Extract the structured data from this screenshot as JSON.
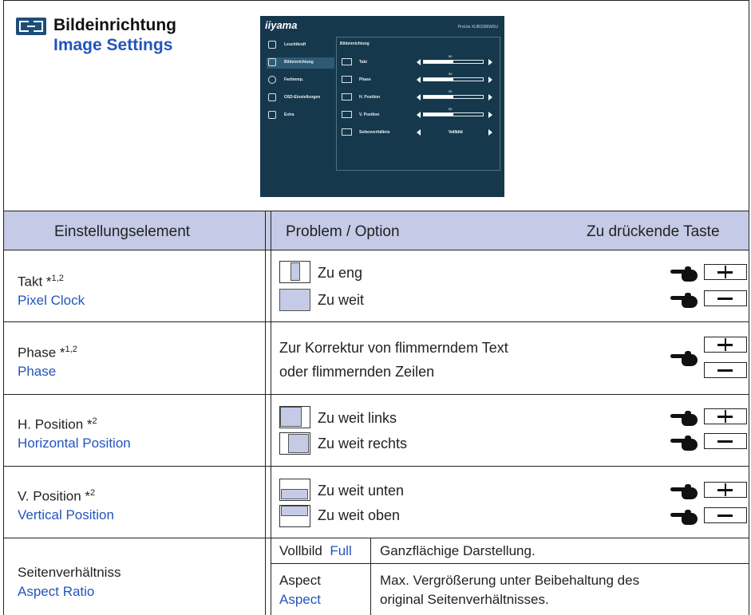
{
  "section": {
    "icon": "image-settings-icon",
    "title_de": "Bildeinrichtung",
    "title_en": "Image Settings"
  },
  "osd": {
    "logo": "iiyama",
    "model": "ProLite XUB2395WSU",
    "menu": [
      {
        "label": "Leuchtkraft",
        "icon": "brightness-icon"
      },
      {
        "label": "Bildeinrichtung",
        "icon": "image-settings-icon"
      },
      {
        "label": "Farbtemp.",
        "icon": "color-temp-icon"
      },
      {
        "label": "OSD-Einstellungen",
        "icon": "osd-settings-icon"
      },
      {
        "label": "Extra",
        "icon": "extra-icon"
      }
    ],
    "panel_title": "Bildeinrichtung",
    "rows": [
      {
        "label": "Takt",
        "value": "50",
        "level": 0.5
      },
      {
        "label": "Phase",
        "value": "50",
        "level": 0.5
      },
      {
        "label": "H. Position",
        "value": "50",
        "level": 0.5
      },
      {
        "label": "V. Position",
        "value": "50",
        "level": 0.5
      },
      {
        "label": "Seitenverhältnis",
        "value": "Vollbild"
      }
    ]
  },
  "table": {
    "col1": "Einstellungselement",
    "col2": "Problem / Option",
    "col3": "Zu drückende Taste",
    "rows": [
      {
        "de": "Takt *",
        "sup": "1,2",
        "en": "Pixel Clock",
        "opt1": "Zu eng",
        "opt2": "Zu weit"
      },
      {
        "de": "Phase *",
        "sup": "1,2",
        "en": "Phase",
        "opt1": "Zur Korrektur von flimmerndem Text",
        "opt2": "oder flimmernden Zeilen"
      },
      {
        "de": "H. Position *",
        "sup": "2",
        "en": "Horizontal Position",
        "opt1": "Zu weit links",
        "opt2": "Zu weit rechts"
      },
      {
        "de": "V. Position *",
        "sup": "2",
        "en": "Vertical Position",
        "opt1": "Zu weit unten",
        "opt2": "Zu weit oben"
      }
    ],
    "aspect": {
      "de": "Seitenverhältniss",
      "en": "Aspect Ratio",
      "full_de": "Vollbild",
      "full_en": "Full",
      "full_desc": "Ganzflächige Darstellung.",
      "aspect_de": "Aspect",
      "aspect_en": "Aspect",
      "aspect_desc_1": "Max. Vergrößerung unter Beibehaltung des",
      "aspect_desc_2": "original Seitenverhältnisses."
    }
  },
  "keys": {
    "plus": "plus-key-icon",
    "minus": "minus-key-icon",
    "hand": "pointing-hand-icon"
  },
  "colors": {
    "header_bg": "#c5cae6",
    "blue_text": "#2255bb",
    "osd_bg": "#16384d"
  }
}
